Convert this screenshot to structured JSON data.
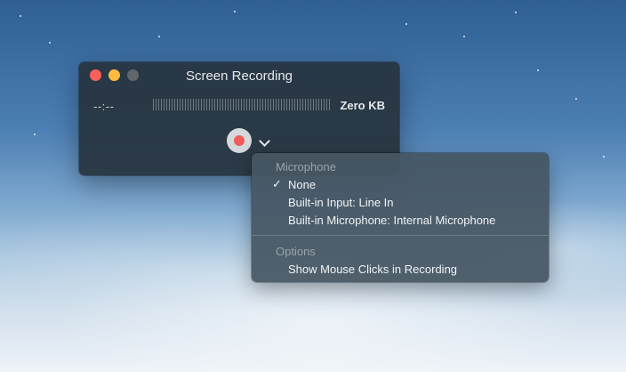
{
  "window": {
    "title": "Screen Recording",
    "time": "--:--",
    "file_size": "Zero KB"
  },
  "menu": {
    "microphone_header": "Microphone",
    "microphone_items": [
      {
        "label": "None",
        "checked": true
      },
      {
        "label": "Built-in Input: Line In",
        "checked": false
      },
      {
        "label": "Built-in Microphone: Internal Microphone",
        "checked": false
      }
    ],
    "check_mark": "✓",
    "options_header": "Options",
    "options_items": [
      {
        "label": "Show Mouse Clicks in Recording"
      }
    ]
  },
  "colors": {
    "close": "#fc605c",
    "minimize": "#fdbc40",
    "zoom_disabled": "#5f666c",
    "record": "#f05b5b"
  },
  "icons": [
    "close-icon",
    "minimize-icon",
    "zoom-icon",
    "record-icon",
    "chevron-down-icon",
    "checkmark-icon"
  ]
}
